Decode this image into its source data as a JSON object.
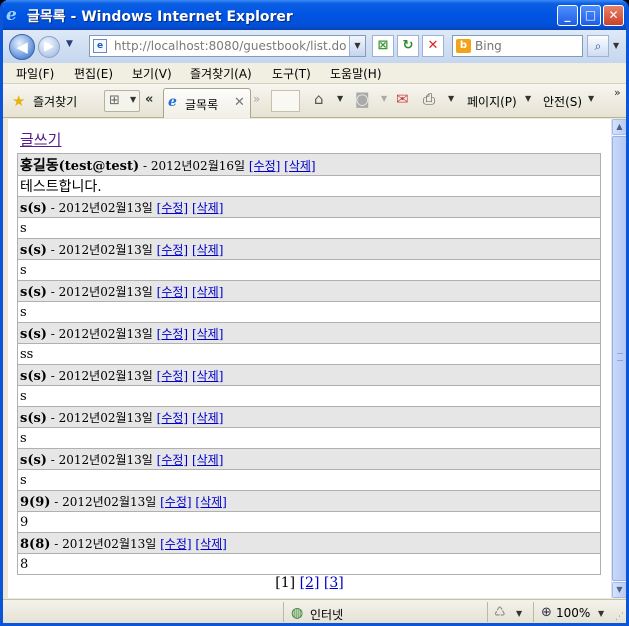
{
  "window": {
    "title": "글목록 - Windows Internet Explorer",
    "ie_icon_glyph": "e",
    "min_glyph": "_",
    "max_glyph": "□",
    "close_glyph": "✕"
  },
  "toolbar": {
    "url": "http://localhost:8080/guestbook/list.do",
    "search_placeholder": "Bing",
    "bing_glyph": "b"
  },
  "menu": {
    "items": [
      "파일(F)",
      "편집(E)",
      "보기(V)",
      "즐겨찾기(A)",
      "도구(T)",
      "도움말(H)"
    ]
  },
  "commandbar": {
    "favorites": "즐겨찾기",
    "tab_title": "글목록",
    "tab_close": "✕",
    "page_menu": "페이지(P)",
    "safety_menu": "안전(S)"
  },
  "page": {
    "write_link": "글쓰기",
    "edit_label": "[수정]",
    "delete_label": "[삭제]",
    "entries": [
      {
        "author": "홍길동",
        "email": "(test@test)",
        "date": "2012년02월16일",
        "content": "테스트합니다."
      },
      {
        "author": "s",
        "email": "(s)",
        "date": "2012년02월13일",
        "content": "s"
      },
      {
        "author": "s",
        "email": "(s)",
        "date": "2012년02월13일",
        "content": "s"
      },
      {
        "author": "s",
        "email": "(s)",
        "date": "2012년02월13일",
        "content": "s"
      },
      {
        "author": "s",
        "email": "(s)",
        "date": "2012년02월13일",
        "content": "ss"
      },
      {
        "author": "s",
        "email": "(s)",
        "date": "2012년02월13일",
        "content": "s"
      },
      {
        "author": "s",
        "email": "(s)",
        "date": "2012년02월13일",
        "content": "s"
      },
      {
        "author": "s",
        "email": "(s)",
        "date": "2012년02월13일",
        "content": "s"
      },
      {
        "author": "9",
        "email": "(9)",
        "date": "2012년02월13일",
        "content": "9"
      },
      {
        "author": "8",
        "email": "(8)",
        "date": "2012년02월13일",
        "content": "8"
      }
    ],
    "pagination": {
      "current": "[1]",
      "pages": [
        "[2]",
        "[3]"
      ]
    }
  },
  "statusbar": {
    "zone": "인터넷",
    "zoom": "100%"
  }
}
